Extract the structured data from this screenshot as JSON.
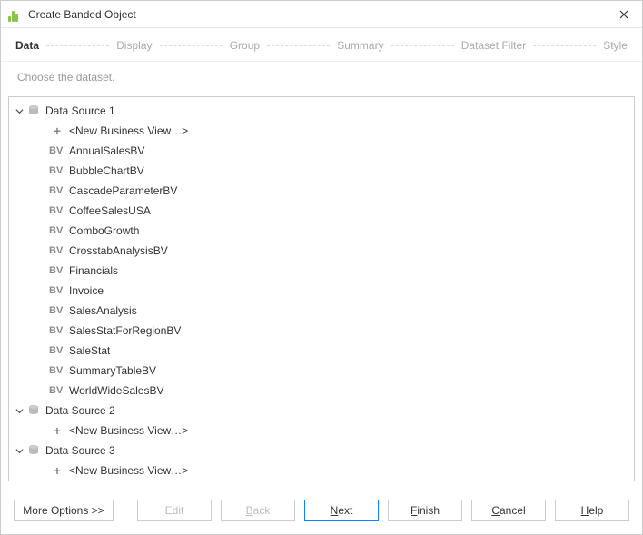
{
  "window": {
    "title": "Create Banded Object"
  },
  "steps": {
    "items": [
      {
        "label": "Data",
        "active": true
      },
      {
        "label": "Display",
        "active": false
      },
      {
        "label": "Group",
        "active": false
      },
      {
        "label": "Summary",
        "active": false
      },
      {
        "label": "Dataset Filter",
        "active": false
      },
      {
        "label": "Style",
        "active": false
      }
    ]
  },
  "hint": "Choose the dataset.",
  "tree": {
    "sources": [
      {
        "name": "Data Source 1",
        "new_label": "<New Business View…>",
        "items": [
          "AnnualSalesBV",
          "BubbleChartBV",
          "CascadeParameterBV",
          "CoffeeSalesUSA",
          "ComboGrowth",
          "CrosstabAnalysisBV",
          "Financials",
          "Invoice",
          "SalesAnalysis",
          "SalesStatForRegionBV",
          "SaleStat",
          "SummaryTableBV",
          "WorldWideSalesBV"
        ]
      },
      {
        "name": "Data Source 2",
        "new_label": "<New Business View…>",
        "items": []
      },
      {
        "name": "Data Source 3",
        "new_label": "<New Business View…>",
        "items": []
      }
    ]
  },
  "buttons": {
    "more_options": "More Options >>",
    "edit": "Edit",
    "back": "Back",
    "next": "Next",
    "finish": "Finish",
    "cancel": "Cancel",
    "help": "Help"
  },
  "bv_badge": "BV"
}
